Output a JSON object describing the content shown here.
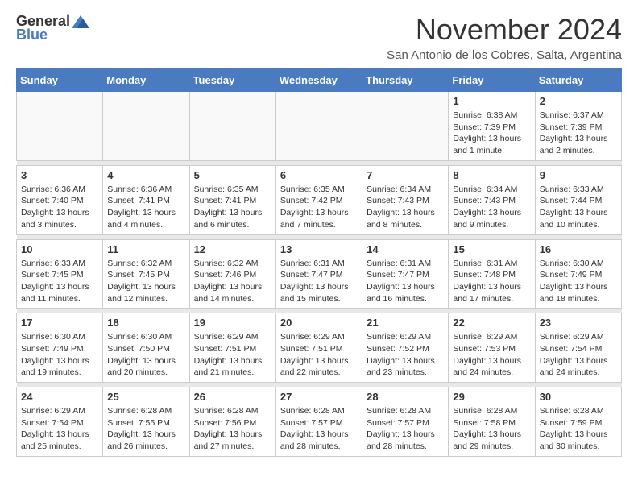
{
  "header": {
    "logo_general": "General",
    "logo_blue": "Blue",
    "month_title": "November 2024",
    "subtitle": "San Antonio de los Cobres, Salta, Argentina"
  },
  "weekdays": [
    "Sunday",
    "Monday",
    "Tuesday",
    "Wednesday",
    "Thursday",
    "Friday",
    "Saturday"
  ],
  "weeks": [
    [
      {
        "day": "",
        "info": ""
      },
      {
        "day": "",
        "info": ""
      },
      {
        "day": "",
        "info": ""
      },
      {
        "day": "",
        "info": ""
      },
      {
        "day": "",
        "info": ""
      },
      {
        "day": "1",
        "info": "Sunrise: 6:38 AM\nSunset: 7:39 PM\nDaylight: 13 hours and 1 minute."
      },
      {
        "day": "2",
        "info": "Sunrise: 6:37 AM\nSunset: 7:39 PM\nDaylight: 13 hours and 2 minutes."
      }
    ],
    [
      {
        "day": "3",
        "info": "Sunrise: 6:36 AM\nSunset: 7:40 PM\nDaylight: 13 hours and 3 minutes."
      },
      {
        "day": "4",
        "info": "Sunrise: 6:36 AM\nSunset: 7:41 PM\nDaylight: 13 hours and 4 minutes."
      },
      {
        "day": "5",
        "info": "Sunrise: 6:35 AM\nSunset: 7:41 PM\nDaylight: 13 hours and 6 minutes."
      },
      {
        "day": "6",
        "info": "Sunrise: 6:35 AM\nSunset: 7:42 PM\nDaylight: 13 hours and 7 minutes."
      },
      {
        "day": "7",
        "info": "Sunrise: 6:34 AM\nSunset: 7:43 PM\nDaylight: 13 hours and 8 minutes."
      },
      {
        "day": "8",
        "info": "Sunrise: 6:34 AM\nSunset: 7:43 PM\nDaylight: 13 hours and 9 minutes."
      },
      {
        "day": "9",
        "info": "Sunrise: 6:33 AM\nSunset: 7:44 PM\nDaylight: 13 hours and 10 minutes."
      }
    ],
    [
      {
        "day": "10",
        "info": "Sunrise: 6:33 AM\nSunset: 7:45 PM\nDaylight: 13 hours and 11 minutes."
      },
      {
        "day": "11",
        "info": "Sunrise: 6:32 AM\nSunset: 7:45 PM\nDaylight: 13 hours and 12 minutes."
      },
      {
        "day": "12",
        "info": "Sunrise: 6:32 AM\nSunset: 7:46 PM\nDaylight: 13 hours and 14 minutes."
      },
      {
        "day": "13",
        "info": "Sunrise: 6:31 AM\nSunset: 7:47 PM\nDaylight: 13 hours and 15 minutes."
      },
      {
        "day": "14",
        "info": "Sunrise: 6:31 AM\nSunset: 7:47 PM\nDaylight: 13 hours and 16 minutes."
      },
      {
        "day": "15",
        "info": "Sunrise: 6:31 AM\nSunset: 7:48 PM\nDaylight: 13 hours and 17 minutes."
      },
      {
        "day": "16",
        "info": "Sunrise: 6:30 AM\nSunset: 7:49 PM\nDaylight: 13 hours and 18 minutes."
      }
    ],
    [
      {
        "day": "17",
        "info": "Sunrise: 6:30 AM\nSunset: 7:49 PM\nDaylight: 13 hours and 19 minutes."
      },
      {
        "day": "18",
        "info": "Sunrise: 6:30 AM\nSunset: 7:50 PM\nDaylight: 13 hours and 20 minutes."
      },
      {
        "day": "19",
        "info": "Sunrise: 6:29 AM\nSunset: 7:51 PM\nDaylight: 13 hours and 21 minutes."
      },
      {
        "day": "20",
        "info": "Sunrise: 6:29 AM\nSunset: 7:51 PM\nDaylight: 13 hours and 22 minutes."
      },
      {
        "day": "21",
        "info": "Sunrise: 6:29 AM\nSunset: 7:52 PM\nDaylight: 13 hours and 23 minutes."
      },
      {
        "day": "22",
        "info": "Sunrise: 6:29 AM\nSunset: 7:53 PM\nDaylight: 13 hours and 24 minutes."
      },
      {
        "day": "23",
        "info": "Sunrise: 6:29 AM\nSunset: 7:54 PM\nDaylight: 13 hours and 24 minutes."
      }
    ],
    [
      {
        "day": "24",
        "info": "Sunrise: 6:29 AM\nSunset: 7:54 PM\nDaylight: 13 hours and 25 minutes."
      },
      {
        "day": "25",
        "info": "Sunrise: 6:28 AM\nSunset: 7:55 PM\nDaylight: 13 hours and 26 minutes."
      },
      {
        "day": "26",
        "info": "Sunrise: 6:28 AM\nSunset: 7:56 PM\nDaylight: 13 hours and 27 minutes."
      },
      {
        "day": "27",
        "info": "Sunrise: 6:28 AM\nSunset: 7:57 PM\nDaylight: 13 hours and 28 minutes."
      },
      {
        "day": "28",
        "info": "Sunrise: 6:28 AM\nSunset: 7:57 PM\nDaylight: 13 hours and 28 minutes."
      },
      {
        "day": "29",
        "info": "Sunrise: 6:28 AM\nSunset: 7:58 PM\nDaylight: 13 hours and 29 minutes."
      },
      {
        "day": "30",
        "info": "Sunrise: 6:28 AM\nSunset: 7:59 PM\nDaylight: 13 hours and 30 minutes."
      }
    ]
  ]
}
